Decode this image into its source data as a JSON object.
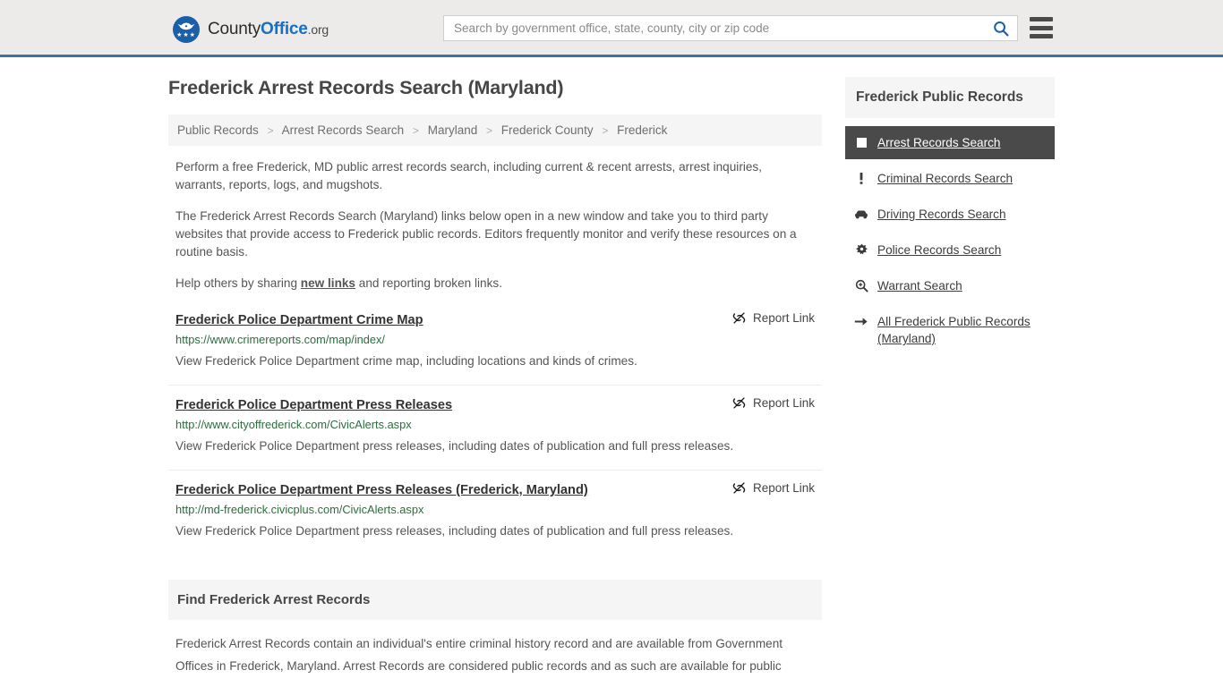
{
  "header": {
    "brand_part1": "County",
    "brand_part2": "Office",
    "brand_suffix": ".org",
    "search_placeholder": "Search by government office, state, county, city or zip code",
    "search_value": "",
    "search_icon": "search-icon",
    "menu_icon": "hamburger-menu-icon",
    "accent_color": "#3A72A8",
    "background_color": "#ECEBEA"
  },
  "main": {
    "page_title": "Frederick Arrest Records Search (Maryland)",
    "breadcrumb": {
      "separator": ">",
      "items": [
        {
          "label": "Public Records"
        },
        {
          "label": "Arrest Records Search"
        },
        {
          "label": "Maryland"
        },
        {
          "label": "Frederick County"
        },
        {
          "label": "Frederick"
        }
      ]
    },
    "intro_paragraph_1": "Perform a free Frederick, MD public arrest records search, including current & recent arrests, arrest inquiries, warrants, reports, logs, and mugshots.",
    "intro_paragraph_2": "The Frederick Arrest Records Search (Maryland) links below open in a new window and take you to third party websites that provide access to Frederick public records. Editors frequently monitor and verify these resources on a routine basis.",
    "intro_paragraph_3_before": "Help others by sharing ",
    "intro_paragraph_3_link": "new links",
    "intro_paragraph_3_after": " and reporting broken links.",
    "report_link_label": "Report Link",
    "report_link_icon": "unlink-icon",
    "results": [
      {
        "title": "Frederick Police Department Crime Map",
        "url": "https://www.crimereports.com/map/index/",
        "description": "View Frederick Police Department crime map, including locations and kinds of crimes.",
        "report_label": "Report Link"
      },
      {
        "title": "Frederick Police Department Press Releases",
        "url": "http://www.cityoffrederick.com/CivicAlerts.aspx",
        "description": "View Frederick Police Department press releases, including dates of publication and full press releases.",
        "report_label": "Report Link"
      },
      {
        "title": "Frederick Police Department Press Releases (Frederick, Maryland)",
        "url": "http://md-frederick.civicplus.com/CivicAlerts.aspx",
        "description": "View Frederick Police Department press releases, including dates of publication and full press releases.",
        "report_label": "Report Link"
      }
    ],
    "find_section": {
      "heading": "Find Frederick Arrest Records",
      "body": "Frederick Arrest Records contain an individual's entire criminal history record and are available from Government Offices in Frederick, Maryland. Arrest Records are considered public records and as such are available for public"
    }
  },
  "sidebar": {
    "heading": "Frederick Public Records",
    "active_background": "#4A4A4A",
    "items": [
      {
        "label": "Arrest Records Search",
        "icon": "square-icon",
        "active": true
      },
      {
        "label": "Criminal Records Search",
        "icon": "exclamation-icon",
        "active": false
      },
      {
        "label": "Driving Records Search",
        "icon": "car-icon",
        "active": false
      },
      {
        "label": "Police Records Search",
        "icon": "police-badge-icon",
        "active": false
      },
      {
        "label": "Warrant Search",
        "icon": "magnifier-plus-icon",
        "active": false
      },
      {
        "label": "All Frederick Public Records (Maryland)",
        "icon": "arrow-right-icon",
        "active": false
      }
    ]
  }
}
